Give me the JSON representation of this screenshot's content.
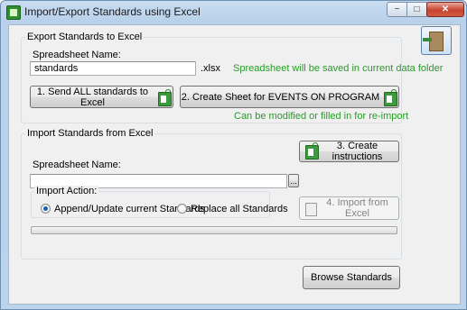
{
  "window": {
    "title": "Import/Export Standards using Excel",
    "minimize": "−",
    "maximize": "□",
    "close": "✕"
  },
  "export": {
    "group_label": "Export Standards to Excel",
    "sheet_label": "Spreadsheet Name:",
    "sheet_value": "standards",
    "extension": ".xlsx",
    "save_note": "Spreadsheet will be saved in current data folder",
    "send_all_button": "1. Send ALL standards to Excel",
    "create_sheet_button": "2. Create Sheet for EVENTS ON PROGRAM",
    "modify_note": "Can be modified or filled in for re-import"
  },
  "import": {
    "group_label": "Import Standards from Excel",
    "create_instructions_button": "3. Create instructions",
    "sheet_label": "Spreadsheet Name:",
    "sheet_value": "",
    "browse_ellipsis": "...",
    "action_label": "Import Action:",
    "option_append": "Append/Update current Standards",
    "option_replace": "Replace all Standards",
    "import_button": "4. Import from Excel",
    "progress": 0
  },
  "footer": {
    "browse_standards_button": "Browse Standards"
  },
  "colors": {
    "accent_green": "#2a9a2a",
    "title_gradient": "#c9ddf2"
  }
}
